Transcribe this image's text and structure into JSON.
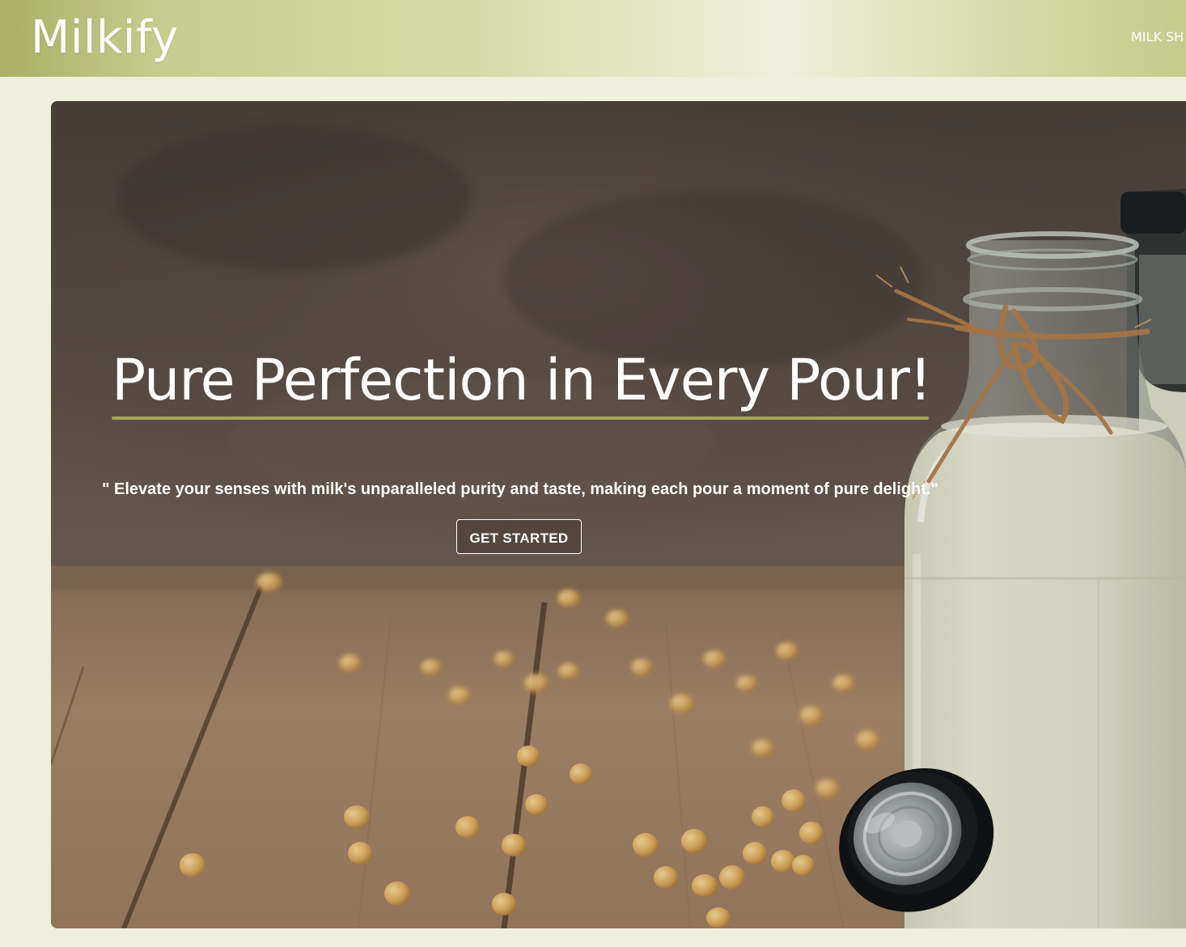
{
  "navbar": {
    "brand": "Milkify",
    "links": [
      {
        "label": "MILK SH"
      }
    ]
  },
  "hero": {
    "title": "Pure Perfection in Every Pour!",
    "quote": "\" Elevate your senses with milk's unparalleled purity and taste, making each pour a moment of pure delight.\"",
    "cta_label": "GET STARTED"
  },
  "colors": {
    "page_background": "#eef0dc",
    "navbar_olive": "#a9b064",
    "accent_underline": "#a3a85a",
    "text_light": "#ffffff"
  }
}
